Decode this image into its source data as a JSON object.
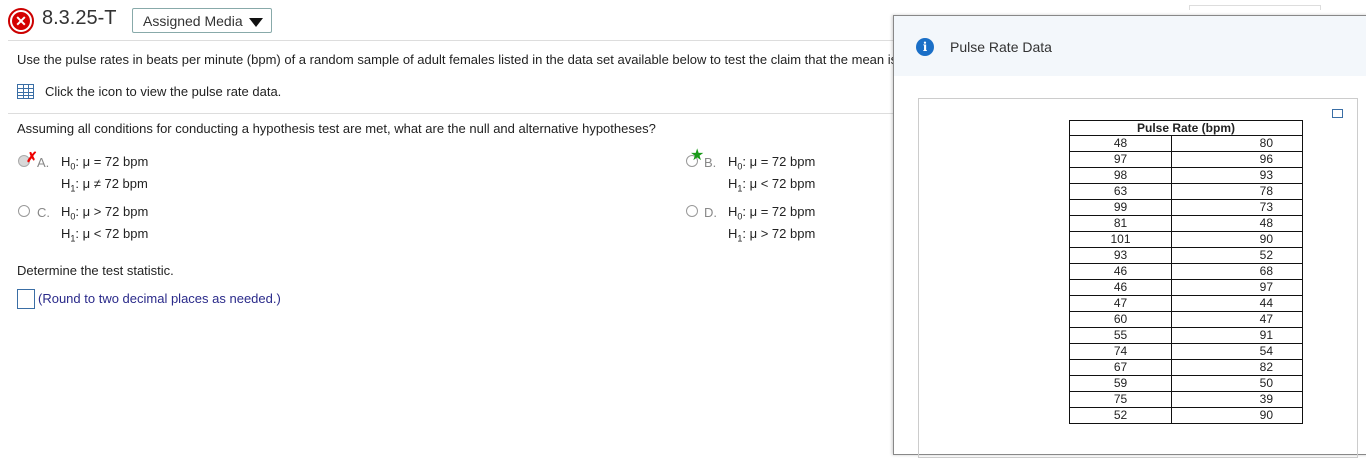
{
  "header": {
    "problem_id": "8.3.25-T",
    "media_button": "Assigned Media"
  },
  "question": {
    "intro": "Use the pulse rates in beats per minute (bpm) of a random sample of adult females listed in the data set available below to test the claim that the mean is",
    "data_link": "Click the icon to view the pulse rate data.",
    "part1_prompt": "Assuming all conditions for conducting a hypothesis test are met, what are the null and alternative hypotheses?",
    "options": [
      {
        "letter": "A.",
        "h0": "H0: μ = 72 bpm",
        "h1": "H1: μ ≠ 72 bpm"
      },
      {
        "letter": "B.",
        "h0": "H0: μ = 72 bpm",
        "h1": "H1: μ < 72 bpm"
      },
      {
        "letter": "C.",
        "h0": "H0: μ > 72 bpm",
        "h1": "H1: μ < 72 bpm"
      },
      {
        "letter": "D.",
        "h0": "H0: μ = 72 bpm",
        "h1": "H1: μ > 72 bpm"
      }
    ],
    "part2_prompt": "Determine the test statistic.",
    "hint": "(Round to two decimal places as needed.)"
  },
  "popup": {
    "title": "Pulse Rate Data",
    "table_header": "Pulse Rate (bpm)",
    "rows": [
      [
        "48",
        "80"
      ],
      [
        "97",
        "96"
      ],
      [
        "98",
        "93"
      ],
      [
        "63",
        "78"
      ],
      [
        "99",
        "73"
      ],
      [
        "81",
        "48"
      ],
      [
        "101",
        "90"
      ],
      [
        "93",
        "52"
      ],
      [
        "46",
        "68"
      ],
      [
        "46",
        "97"
      ],
      [
        "47",
        "44"
      ],
      [
        "60",
        "47"
      ],
      [
        "55",
        "91"
      ],
      [
        "74",
        "54"
      ],
      [
        "67",
        "82"
      ],
      [
        "59",
        "50"
      ],
      [
        "75",
        "39"
      ],
      [
        "52",
        "90"
      ]
    ]
  }
}
